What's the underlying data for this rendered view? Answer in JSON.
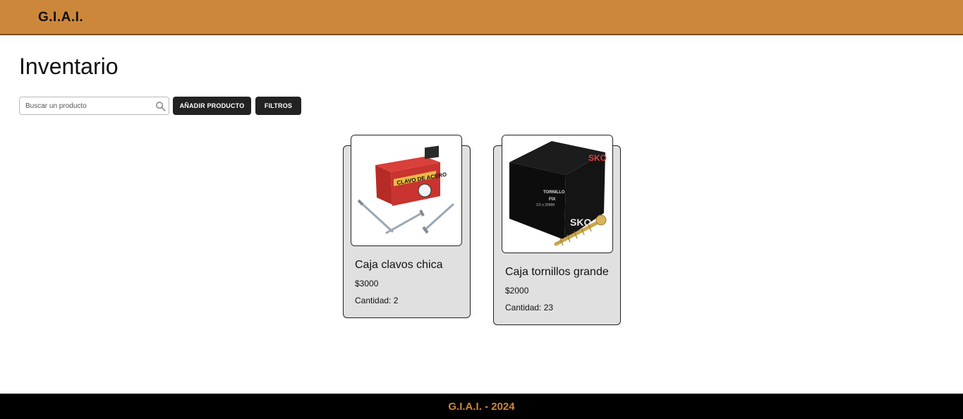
{
  "header": {
    "brand": "G.I.A.I."
  },
  "main": {
    "title": "Inventario",
    "search": {
      "placeholder": "Buscar un producto",
      "value": ""
    },
    "add_button": "AÑADIR PRODUCTO",
    "filter_button": "FILTROS",
    "products": [
      {
        "name": "Caja clavos chica",
        "price": "$3000",
        "quantity": "Cantidad: 2",
        "image": "nail-box-image"
      },
      {
        "name": "Caja tornillos grande",
        "price": "$2000",
        "quantity": "Cantidad: 23",
        "image": "screw-box-image"
      }
    ]
  },
  "footer": {
    "text": "G.I.A.I. - 2024"
  },
  "colors": {
    "brand": "#cd873a",
    "button": "#222222",
    "card": "#e0e0e0",
    "footer": "#000000"
  }
}
